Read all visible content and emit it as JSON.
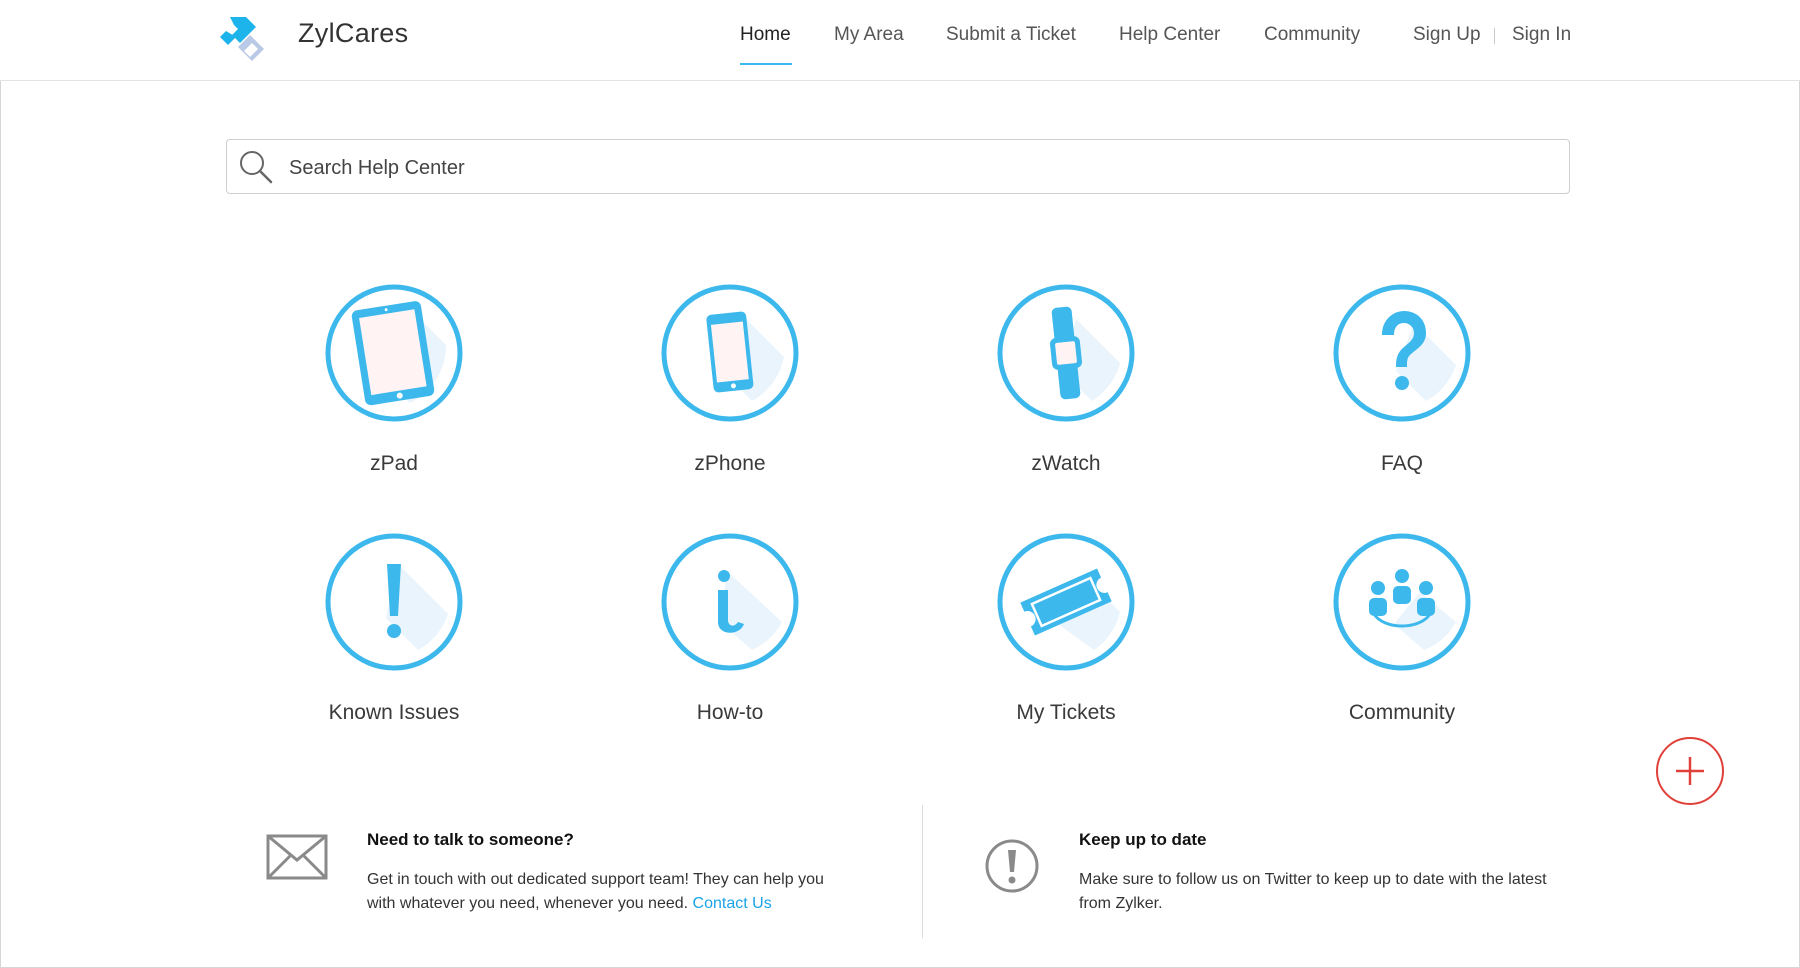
{
  "brand": {
    "name": "ZylCares"
  },
  "nav": {
    "items": [
      {
        "label": "Home",
        "active": true
      },
      {
        "label": "My Area"
      },
      {
        "label": "Submit a Ticket"
      },
      {
        "label": "Help Center"
      },
      {
        "label": "Community"
      }
    ],
    "signup": "Sign Up",
    "signin": "Sign In"
  },
  "search": {
    "placeholder": "Search Help Center",
    "value": ""
  },
  "categories": [
    {
      "label": "zPad",
      "icon": "tablet-icon"
    },
    {
      "label": "zPhone",
      "icon": "phone-icon"
    },
    {
      "label": "zWatch",
      "icon": "watch-icon"
    },
    {
      "label": "FAQ",
      "icon": "question-icon"
    },
    {
      "label": "Known Issues",
      "icon": "exclamation-icon"
    },
    {
      "label": "How-to",
      "icon": "info-icon"
    },
    {
      "label": "My Tickets",
      "icon": "ticket-icon"
    },
    {
      "label": "Community",
      "icon": "people-icon"
    }
  ],
  "footer": {
    "contact": {
      "title": "Need to talk to someone?",
      "text": "Get in touch with out dedicated support team! They can help you with whatever you need, whenever you need.",
      "link": "Contact Us"
    },
    "updates": {
      "title": "Keep up to date",
      "text": "Make sure to follow us on Twitter to keep up to date with the latest from Zylker."
    }
  },
  "colors": {
    "accent": "#3cb8ec",
    "fab": "#e0403a",
    "link": "#1aa3e8"
  }
}
